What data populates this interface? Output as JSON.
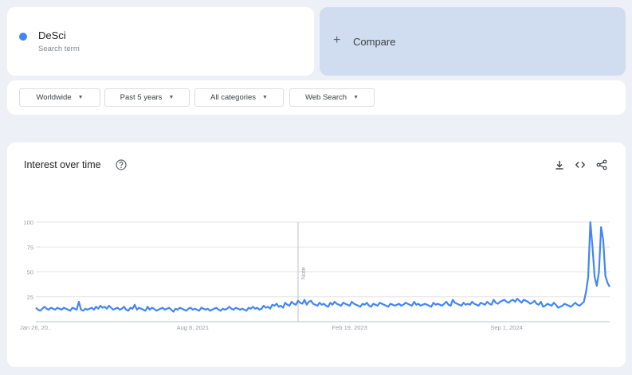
{
  "search_term": {
    "name": "DeSci",
    "subtitle": "Search term",
    "color": "#4285f4"
  },
  "compare": {
    "plus": "+",
    "label": "Compare"
  },
  "filters": [
    {
      "label": "Worldwide"
    },
    {
      "label": "Past 5 years"
    },
    {
      "label": "All categories"
    },
    {
      "label": "Web Search"
    }
  ],
  "chart_section": {
    "title": "Interest over time",
    "icons": [
      "help-icon",
      "download-icon",
      "embed-icon",
      "share-icon"
    ]
  },
  "chart_data": {
    "type": "line",
    "title": "Interest over time",
    "y_ticks": [
      "100",
      "75",
      "50",
      "25"
    ],
    "ylim": [
      0,
      100
    ],
    "x_tick_labels": [
      "Jan 26, 20..",
      "Aug 8, 2021",
      "Feb 19, 2023",
      "Sep 1, 2024"
    ],
    "note_label": "Note",
    "grid": true,
    "series": [
      {
        "color": "#4285f4",
        "values": [
          14,
          12,
          11,
          13,
          15,
          13,
          12,
          14,
          13,
          12,
          14,
          13,
          12,
          14,
          13,
          12,
          11,
          14,
          13,
          12,
          20,
          12,
          11,
          13,
          12,
          13,
          14,
          12,
          15,
          13,
          16,
          14,
          15,
          13,
          16,
          14,
          12,
          13,
          14,
          12,
          13,
          15,
          12,
          11,
          14,
          13,
          17,
          12,
          14,
          13,
          12,
          11,
          15,
          12,
          14,
          13,
          11,
          12,
          13,
          14,
          12,
          13,
          14,
          12,
          10,
          13,
          12,
          14,
          13,
          12,
          11,
          13,
          14,
          12,
          13,
          12,
          11,
          14,
          13,
          12,
          13,
          11,
          12,
          13,
          14,
          12,
          11,
          13,
          12,
          13,
          15,
          13,
          12,
          14,
          13,
          12,
          13,
          12,
          11,
          14,
          13,
          15,
          13,
          14,
          12,
          13,
          16,
          14,
          15,
          13,
          17,
          16,
          18,
          15,
          16,
          14,
          19,
          17,
          16,
          20,
          18,
          17,
          21,
          19,
          18,
          22,
          17,
          20,
          21,
          18,
          17,
          16,
          19,
          17,
          18,
          16,
          15,
          19,
          17,
          20,
          18,
          17,
          16,
          19,
          18,
          17,
          16,
          20,
          18,
          17,
          16,
          15,
          18,
          17,
          19,
          16,
          15,
          18,
          17,
          16,
          19,
          18,
          17,
          16,
          15,
          18,
          17,
          16,
          17,
          18,
          16,
          17,
          19,
          18,
          17,
          16,
          20,
          17,
          18,
          16,
          17,
          18,
          17,
          16,
          15,
          19,
          17,
          18,
          17,
          16,
          18,
          20,
          17,
          16,
          22,
          19,
          18,
          17,
          16,
          19,
          17,
          18,
          17,
          20,
          18,
          17,
          16,
          19,
          18,
          17,
          20,
          18,
          17,
          22,
          19,
          18,
          20,
          21,
          22,
          20,
          19,
          21,
          22,
          20,
          23,
          21,
          19,
          22,
          21,
          20,
          18,
          19,
          21,
          18,
          17,
          20,
          15,
          16,
          18,
          17,
          16,
          19,
          17,
          14,
          15,
          16,
          18,
          17,
          16,
          15,
          17,
          19,
          17,
          16,
          18,
          20,
          30,
          45,
          100,
          75,
          45,
          36,
          50,
          95,
          82,
          46,
          39,
          35
        ]
      }
    ]
  }
}
